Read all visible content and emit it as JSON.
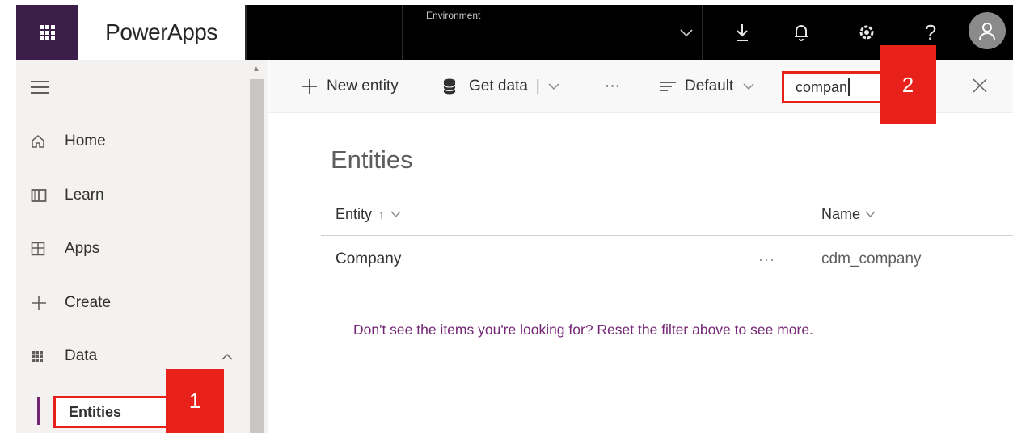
{
  "topbar": {
    "app_name": "PowerApps",
    "environment_label": "Environment",
    "icons": [
      "waffle-icon",
      "chevron-down-icon",
      "download-icon",
      "bell-icon",
      "gear-icon",
      "help-icon",
      "user-icon"
    ],
    "help_glyph": "?",
    "background_color": "#000000",
    "waffle_color": "#3b1f4a"
  },
  "sidebar": {
    "menu_icon": "hamburger-icon",
    "items": [
      {
        "label": "Home",
        "icon": "home-icon"
      },
      {
        "label": "Learn",
        "icon": "book-icon"
      },
      {
        "label": "Apps",
        "icon": "apps-icon"
      },
      {
        "label": "Create",
        "icon": "plus-icon"
      },
      {
        "label": "Data",
        "icon": "table-icon"
      }
    ],
    "sub_item": {
      "label": "Entities"
    },
    "accent_color": "#742774"
  },
  "commandbar": {
    "new_entity": "New entity",
    "get_data": "Get data",
    "more": "···",
    "view": "Default",
    "search_value": "compan"
  },
  "content": {
    "title": "Entities",
    "columns": [
      {
        "label": "Entity",
        "sort": "↑"
      },
      {
        "label": "Name"
      }
    ],
    "rows": [
      {
        "entity": "Company",
        "more": "···",
        "name": "cdm_company"
      }
    ],
    "hint": "Don't see the items you're looking for? Reset the filter above to see more."
  },
  "annotations": {
    "badge_1": "1",
    "badge_2": "2",
    "highlight_color": "#e8221b"
  }
}
